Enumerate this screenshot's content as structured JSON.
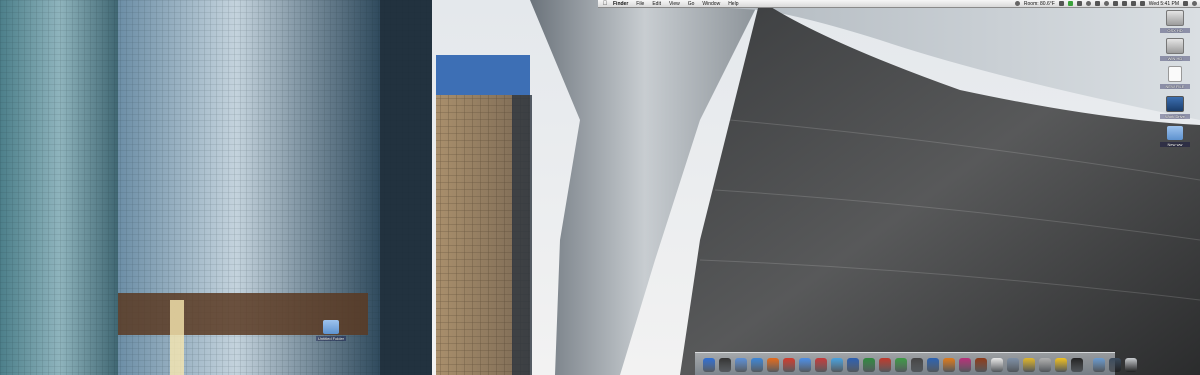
{
  "menubar": {
    "app_name": "Finder",
    "menus": [
      "File",
      "Edit",
      "View",
      "Go",
      "Window",
      "Help"
    ],
    "room_temp": "Room: 80.6°F",
    "clock": "Wed 5:41 PM"
  },
  "desktop_icons": [
    {
      "label": "OSX HD"
    },
    {
      "label": "WIN HD"
    },
    {
      "label": "NEW FILE"
    },
    {
      "label": "Work Drive"
    },
    {
      "label": "New ww"
    },
    {
      "label": "Untitled Folder"
    }
  ],
  "dock": {
    "apps": [
      {
        "name": "finder",
        "color": "#2f6fd6"
      },
      {
        "name": "dashboard",
        "color": "#333333"
      },
      {
        "name": "mail",
        "color": "#5b8fd8"
      },
      {
        "name": "safari",
        "color": "#3b86d8"
      },
      {
        "name": "firefox",
        "color": "#e56a1a"
      },
      {
        "name": "chrome",
        "color": "#d33b2c"
      },
      {
        "name": "ichat",
        "color": "#4b8ee8"
      },
      {
        "name": "ical",
        "color": "#c63a3a"
      },
      {
        "name": "itunes",
        "color": "#47a2e0"
      },
      {
        "name": "word",
        "color": "#2b5fb3"
      },
      {
        "name": "excel",
        "color": "#2f8a3f"
      },
      {
        "name": "app-red",
        "color": "#c0392b"
      },
      {
        "name": "app-green",
        "color": "#3d9b45"
      },
      {
        "name": "app-dark",
        "color": "#444444"
      },
      {
        "name": "photoshop",
        "color": "#2a62b3"
      },
      {
        "name": "illustrator",
        "color": "#e07a1a"
      },
      {
        "name": "indesign",
        "color": "#b8307a"
      },
      {
        "name": "bridge",
        "color": "#8e3a18"
      },
      {
        "name": "acrobat",
        "color": "#e8e8e8"
      },
      {
        "name": "preview",
        "color": "#7d8fa6"
      },
      {
        "name": "app-yellow",
        "color": "#e0b62a"
      },
      {
        "name": "disk-utility",
        "color": "#b0b0b0"
      },
      {
        "name": "adium",
        "color": "#f0c020"
      },
      {
        "name": "terminal",
        "color": "#222222"
      }
    ],
    "stack_icons": [
      {
        "name": "downloads-stack",
        "color": "#6a9bd0"
      },
      {
        "name": "documents-stack",
        "color": "#3b4b5d"
      },
      {
        "name": "trash",
        "color": "#c9ccd0"
      }
    ]
  }
}
